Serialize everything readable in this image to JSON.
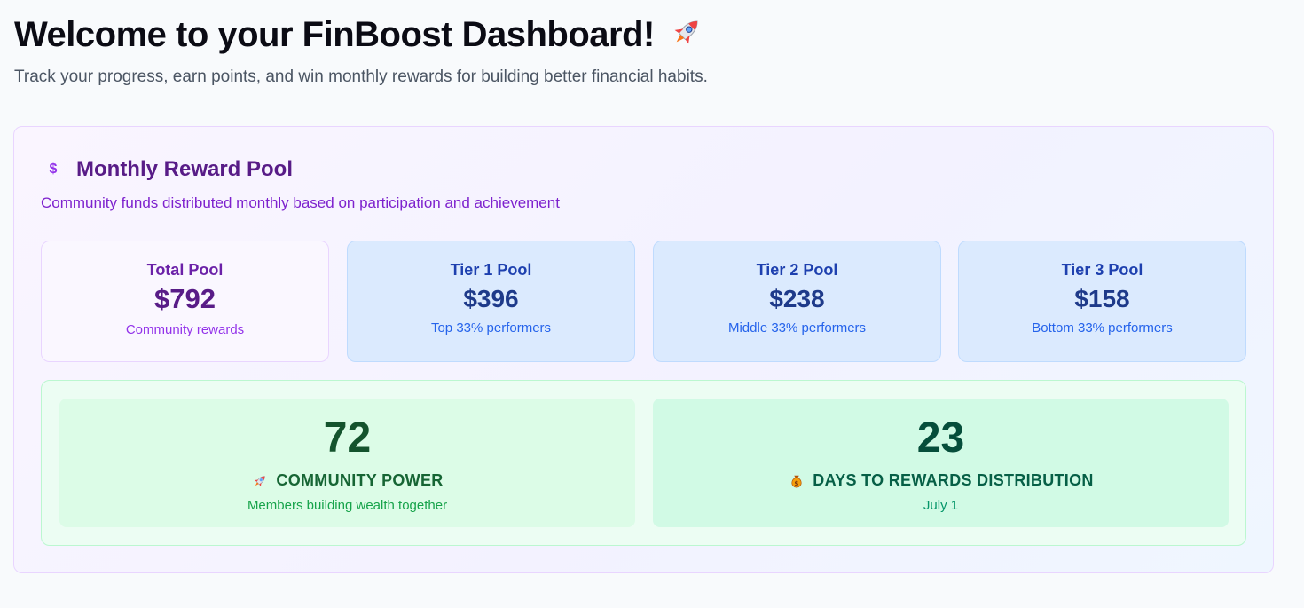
{
  "header": {
    "title": "Welcome to your FinBoost Dashboard!",
    "title_icon": "rocket-icon",
    "subtitle": "Track your progress, earn points, and win monthly rewards for building better financial habits."
  },
  "reward_pool": {
    "icon": "dollar-icon",
    "title": "Monthly Reward Pool",
    "description": "Community funds distributed monthly based on participation and achievement",
    "tiers": [
      {
        "label": "Total Pool",
        "amount": "$792",
        "note": "Community rewards"
      },
      {
        "label": "Tier 1 Pool",
        "amount": "$396",
        "note": "Top 33% performers"
      },
      {
        "label": "Tier 2 Pool",
        "amount": "$238",
        "note": "Middle 33% performers"
      },
      {
        "label": "Tier 3 Pool",
        "amount": "$158",
        "note": "Bottom 33% performers"
      }
    ]
  },
  "stats": {
    "community": {
      "value": "72",
      "icon": "rocket-icon",
      "label": "COMMUNITY POWER",
      "note": "Members building wealth together"
    },
    "countdown": {
      "value": "23",
      "icon": "money-bag-icon",
      "label": "DAYS TO REWARDS DISTRIBUTION",
      "note": "July 1"
    }
  },
  "colors": {
    "purple_title": "#581c87",
    "blue_card": "#dbeafe",
    "green_card": "#dcfce7",
    "accent_purple": "#9333ea"
  }
}
